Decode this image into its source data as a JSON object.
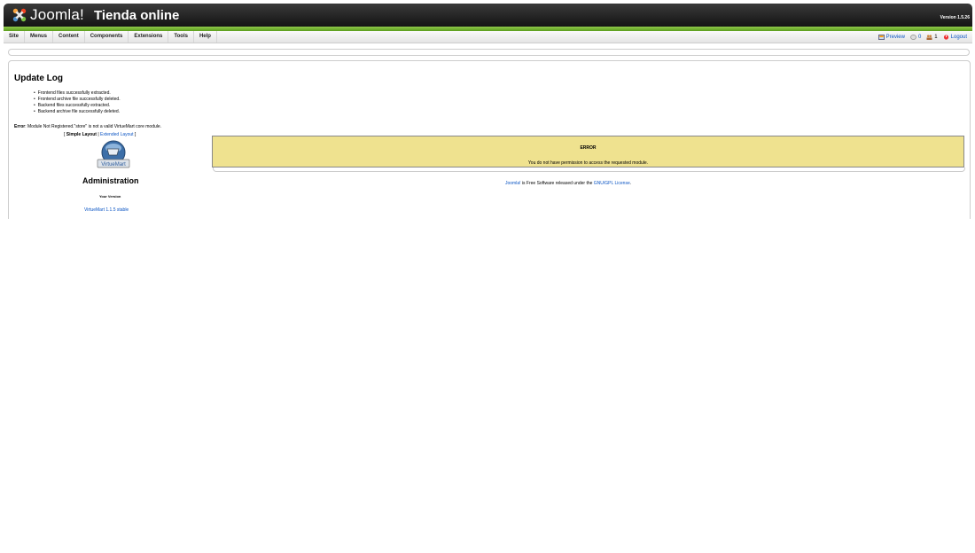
{
  "header": {
    "logo_text": "Joomla!",
    "site_title": "Tienda online",
    "version": "Version 1.5.26"
  },
  "menu": {
    "items": [
      "Site",
      "Menus",
      "Content",
      "Components",
      "Extensions",
      "Tools",
      "Help"
    ],
    "right": {
      "preview": "Preview",
      "messages": "0",
      "users": "1",
      "logout": "Logout"
    }
  },
  "update_log": {
    "title": "Update Log",
    "items": [
      "Frontend files successfully extracted.",
      "Frontend archive file successfully deleted.",
      "Backend files successfully extracted.",
      "Backend archive file successfully deleted."
    ]
  },
  "error_line": {
    "label": "Error",
    "text": ": Module Not Registered.\"store\" is not a valid VirtueMart core module."
  },
  "layout": {
    "open": "[ ",
    "simple": "Simple Layout",
    "sep": " | ",
    "extended": "Extended Layout",
    "close": " ]"
  },
  "vm_logo_text": "VirtueMart",
  "admin": {
    "title": "Administration",
    "your_version": "Your Version",
    "version_link": "VirtueMart 1.1.5 stable"
  },
  "error_box": {
    "heading": "ERROR",
    "message": "You do not have permission to access the requested module."
  },
  "footer": {
    "joomla_link": "Joomla!",
    "text": " is Free Software released under the ",
    "license_link": "GNU/GPL License",
    "end": "."
  },
  "colors": {
    "header_bg": "#1e1e1e",
    "accent_green": "#6aac2a",
    "link": "#0b55c4",
    "error_bg": "#efe28f"
  }
}
